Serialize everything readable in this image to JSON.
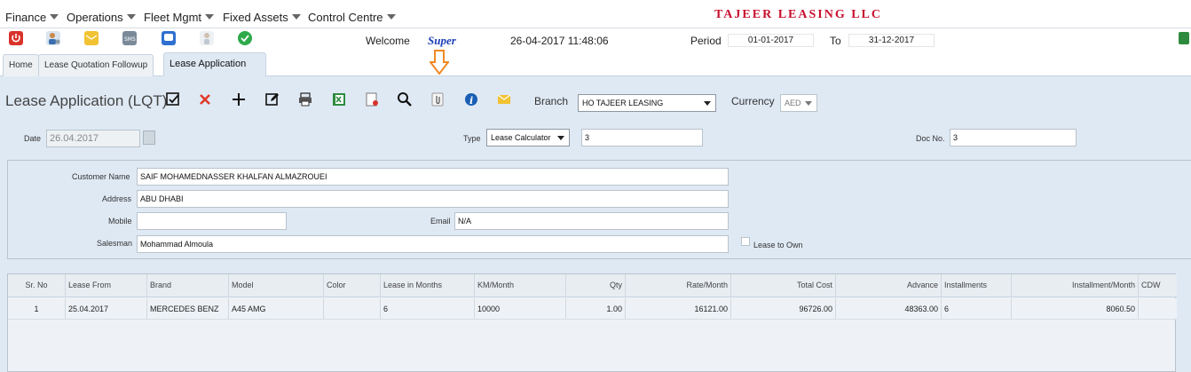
{
  "menu": [
    {
      "label": "Finance"
    },
    {
      "label": "Operations"
    },
    {
      "label": "Fleet Mgmt"
    },
    {
      "label": "Fixed Assets"
    },
    {
      "label": "Control Centre"
    }
  ],
  "company_name": "TAJEER LEASING LLC",
  "topbar": {
    "welcome": "Welcome",
    "user": "Super",
    "datetime": "26-04-2017 11:48:06",
    "period_label": "Period",
    "period_from": "01-01-2017",
    "to_label": "To",
    "period_to": "31-12-2017"
  },
  "tabs": [
    {
      "label": "Home"
    },
    {
      "label": "Lease Quotation Followup"
    },
    {
      "label": "Lease Application"
    }
  ],
  "form": {
    "title": "Lease Application (LQT)",
    "branch_label": "Branch",
    "branch_value": "HO TAJEER LEASING",
    "currency_label": "Currency",
    "currency_value": "AED",
    "date_label": "Date",
    "date_value": "26.04.2017",
    "type_label": "Type",
    "type_value": "Lease Calculator",
    "type_extra": "3",
    "docno_label": "Doc No.",
    "docno_value": "3",
    "customer_label": "Customer Name",
    "customer_value": "SAIF MOHAMEDNASSER KHALFAN ALMAZROUEI",
    "address_label": "Address",
    "address_value": "ABU DHABI",
    "mobile_label": "Mobile",
    "mobile_value": "",
    "email_label": "Email",
    "email_value": "N/A",
    "salesman_label": "Salesman",
    "salesman_value": "Mohammad Almoula",
    "lease_to_own_label": "Lease to Own"
  },
  "grid": {
    "columns": [
      "Sr. No",
      "Lease From",
      "Brand",
      "Model",
      "Color",
      "Lease in Months",
      "KM/Month",
      "Qty",
      "Rate/Month",
      "Total Cost",
      "Advance",
      "Installments",
      "Installment/Month",
      "CDW"
    ],
    "rows": [
      [
        "1",
        "25.04.2017",
        "MERCEDES BENZ",
        "A45 AMG",
        "",
        "6",
        "10000",
        "1.00",
        "16121.00",
        "96726.00",
        "48363.00",
        "6",
        "8060.50",
        ""
      ]
    ]
  },
  "colors": {
    "company": "#c8102e",
    "panel_bg": "#dfe9f4",
    "highlight_arrow": "#f08a24"
  }
}
